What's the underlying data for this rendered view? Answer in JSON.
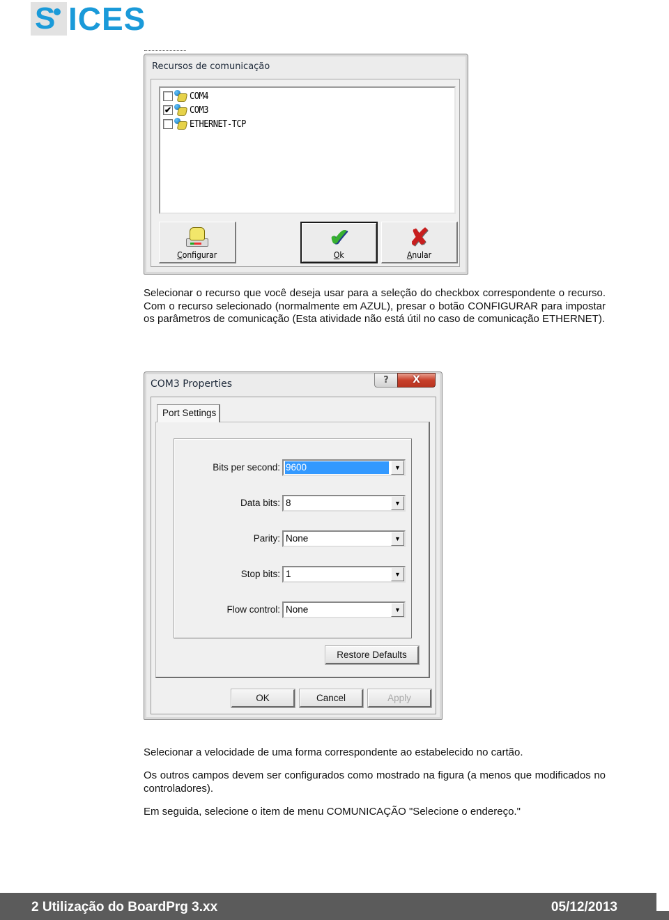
{
  "logo": {
    "text": "ICES",
    "initial": "S",
    "brand_color": "#1a9ad9"
  },
  "dialog_resources": {
    "title": "Recursos de comunicação",
    "items": [
      {
        "label": "COM4",
        "checked": false,
        "icon": "network-phone-icon"
      },
      {
        "label": "COM3",
        "checked": true,
        "icon": "network-phone-icon"
      },
      {
        "label": "ETHERNET-TCP",
        "checked": false,
        "icon": "network-phone-icon"
      }
    ],
    "buttons": {
      "configurar": {
        "label": "Configurar",
        "mnemonic": "C",
        "icon": "telephone-icon"
      },
      "ok": {
        "label": "Ok",
        "mnemonic": "O",
        "icon": "checkmark-icon"
      },
      "anular": {
        "label": "Anular",
        "mnemonic": "A",
        "icon": "red-x-icon"
      }
    }
  },
  "paragraphs": {
    "p1": "Selecionar o recurso que você deseja usar para a seleção do checkbox correspondente o recurso. Com o recurso selecionado (normalmente em AZUL), presar o botão CONFIGURAR para impostar os parâmetros de comunicação (Esta atividade não está útil no caso de comunicação ETHERNET).",
    "p2": "Selecionar a velocidade de uma forma correspondente ao estabelecido no cartão.",
    "p3": "Os outros campos devem ser configurados como mostrado na figura (a menos que modificados no controladores).",
    "p4": "Em seguida, selecione o item de menu COMUNICAÇÃO \"Selecione o endereço.\""
  },
  "dialog_properties": {
    "title": "COM3 Properties",
    "caption_buttons": {
      "help": "?",
      "close": "X"
    },
    "tab": "Port Settings",
    "fields": {
      "bits_per_second": {
        "label": "Bits per second:",
        "value": "9600",
        "selected": true
      },
      "data_bits": {
        "label": "Data bits:",
        "value": "8"
      },
      "parity": {
        "label": "Parity:",
        "value": "None"
      },
      "stop_bits": {
        "label": "Stop bits:",
        "value": "1"
      },
      "flow_control": {
        "label": "Flow control:",
        "value": "None"
      }
    },
    "dropdown_arrow": "▼",
    "buttons": {
      "restore_defaults": "Restore Defaults",
      "ok": "OK",
      "cancel": "Cancel",
      "apply": "Apply"
    },
    "selection_color": "#3399ff"
  },
  "footer": {
    "left": "2  Utilização do BoardPrg 3.xx",
    "right": "05/12/2013",
    "background": "#5b5b5b"
  }
}
